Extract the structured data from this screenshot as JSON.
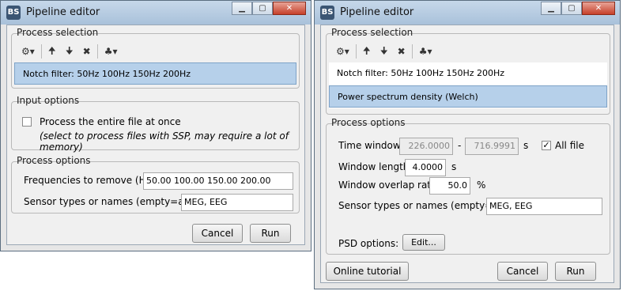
{
  "left": {
    "title": "Pipeline editor",
    "logo": "BS",
    "process_selection_label": "Process selection",
    "process_items": [
      "Notch filter: 50Hz 100Hz 150Hz 200Hz"
    ],
    "input_options_label": "Input options",
    "process_entire_file": "Process the entire file at once",
    "process_entire_file_note": "(select to process files with SSP, may require a lot of memory)",
    "process_options_label": "Process options",
    "freq_label": "Frequencies to remove (Hz):",
    "freq_value": "50.00 100.00 150.00 200.00",
    "sensor_label": "Sensor types or names (empty=all):",
    "sensor_value": "MEG, EEG",
    "cancel": "Cancel",
    "run": "Run"
  },
  "right": {
    "title": "Pipeline editor",
    "logo": "BS",
    "process_selection_label": "Process selection",
    "process_items": [
      "Notch filter: 50Hz 100Hz 150Hz 200Hz",
      "Power spectrum density (Welch)"
    ],
    "process_options_label": "Process options",
    "time_window_label": "Time window:",
    "time_start": "226.0000",
    "time_dash": "-",
    "time_end": "716.9991",
    "time_unit": "s",
    "all_file": "All file",
    "window_length_label": "Window length:",
    "window_length_value": "4.0000",
    "window_length_unit": "s",
    "overlap_label": "Window overlap ratio:",
    "overlap_value": "50.0",
    "overlap_unit": "%",
    "sensor_label": "Sensor types or names (empty=all):",
    "sensor_value": "MEG, EEG",
    "psd_label": "PSD options:",
    "edit": "Edit...",
    "online_tutorial": "Online tutorial",
    "cancel": "Cancel",
    "run": "Run"
  },
  "toolbar_icons": [
    "gear-icon",
    "dropdown-arrow-icon",
    "move-up-icon",
    "move-down-icon",
    "delete-icon",
    "pipeline-tree-icon",
    "dropdown-arrow-icon"
  ],
  "window_buttons": [
    "minimize",
    "maximize",
    "close"
  ]
}
